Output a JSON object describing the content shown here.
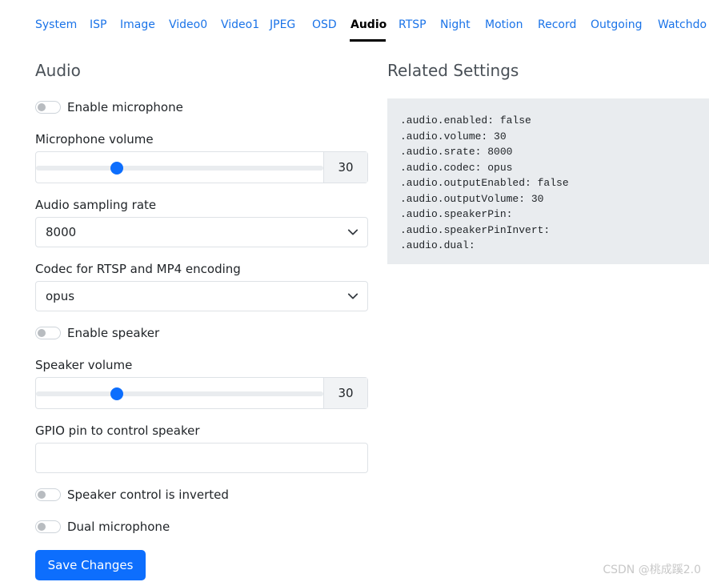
{
  "tabs": [
    {
      "label": "System"
    },
    {
      "label": "ISP"
    },
    {
      "label": "Image"
    },
    {
      "label": "Video0"
    },
    {
      "label": "Video1"
    },
    {
      "label": "JPEG"
    },
    {
      "label": "OSD"
    },
    {
      "label": "Audio",
      "active": true
    },
    {
      "label": "RTSP"
    },
    {
      "label": "Night"
    },
    {
      "label": "Motion"
    },
    {
      "label": "Record"
    },
    {
      "label": "Outgoing"
    },
    {
      "label": "Watchdo"
    }
  ],
  "form": {
    "title": "Audio",
    "enable_microphone": {
      "label": "Enable microphone",
      "checked": false
    },
    "microphone_volume": {
      "label": "Microphone volume",
      "value": "30",
      "level": 0.27
    },
    "sampling_rate": {
      "label": "Audio sampling rate",
      "value": "8000"
    },
    "codec": {
      "label": "Codec for RTSP and MP4 encoding",
      "value": "opus"
    },
    "enable_speaker": {
      "label": "Enable speaker",
      "checked": false
    },
    "speaker_volume": {
      "label": "Speaker volume",
      "value": "30",
      "level": 0.27
    },
    "gpio_pin": {
      "label": "GPIO pin to control speaker",
      "value": "",
      "placeholder": ""
    },
    "speaker_inverted": {
      "label": "Speaker control is inverted",
      "checked": false
    },
    "dual_microphone": {
      "label": "Dual microphone",
      "checked": false
    },
    "save_label": "Save Changes"
  },
  "related": {
    "title": "Related Settings",
    "lines": [
      ".audio.enabled: false",
      ".audio.volume: 30",
      ".audio.srate: 8000",
      ".audio.codec: opus",
      ".audio.outputEnabled: false",
      ".audio.outputVolume: 30",
      ".audio.speakerPin:",
      ".audio.speakerPinInvert:",
      ".audio.dual:"
    ]
  },
  "watermark": "CSDN @桃成蹊2.0",
  "colors": {
    "accent": "#0d6efd",
    "link": "#1a73e8",
    "code_bg": "#e9ecef"
  },
  "icons": {
    "select_arrow": "chevron-down-icon"
  }
}
